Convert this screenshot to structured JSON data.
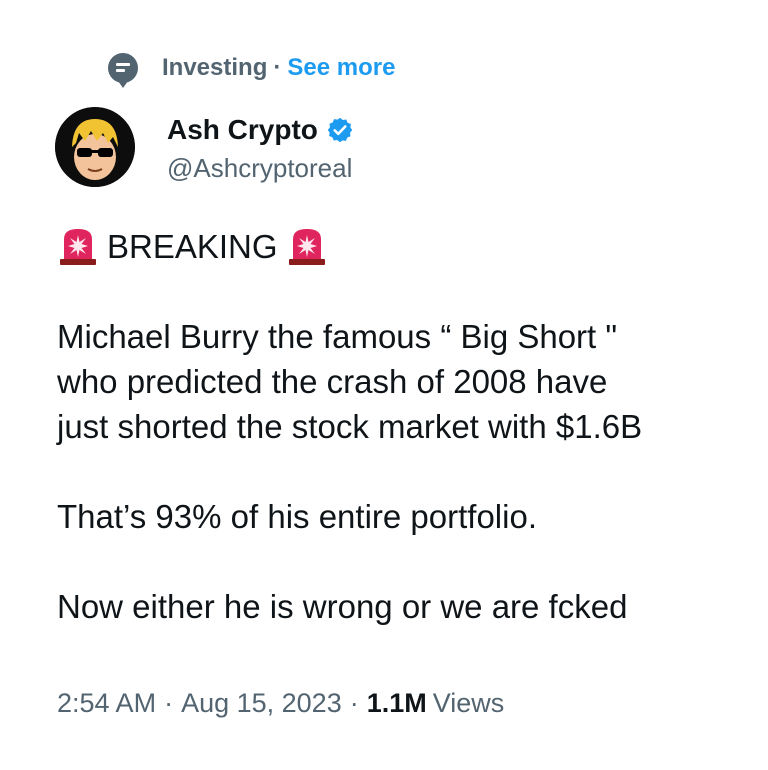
{
  "context": {
    "topic": "Investing",
    "separator": "·",
    "see_more": "See more"
  },
  "author": {
    "display_name": "Ash Crypto",
    "handle": "@Ashcryptoreal"
  },
  "tweet": {
    "headline": "BREAKING",
    "paragraphs": [
      "Michael Burry the famous “ Big Short \"\nwho predicted the crash of 2008 have\njust shorted the stock market with $1.6B",
      "That’s 93% of his entire portfolio.",
      "Now either he is wrong or we are fcked"
    ]
  },
  "meta": {
    "time": "2:54 AM",
    "separator": "·",
    "date": "Aug 15, 2023",
    "views_count": "1.1M",
    "views_label": "Views"
  },
  "colors": {
    "accent": "#1d9bf0",
    "muted": "#536471",
    "text": "#0f1419",
    "siren": "#e0245e"
  }
}
